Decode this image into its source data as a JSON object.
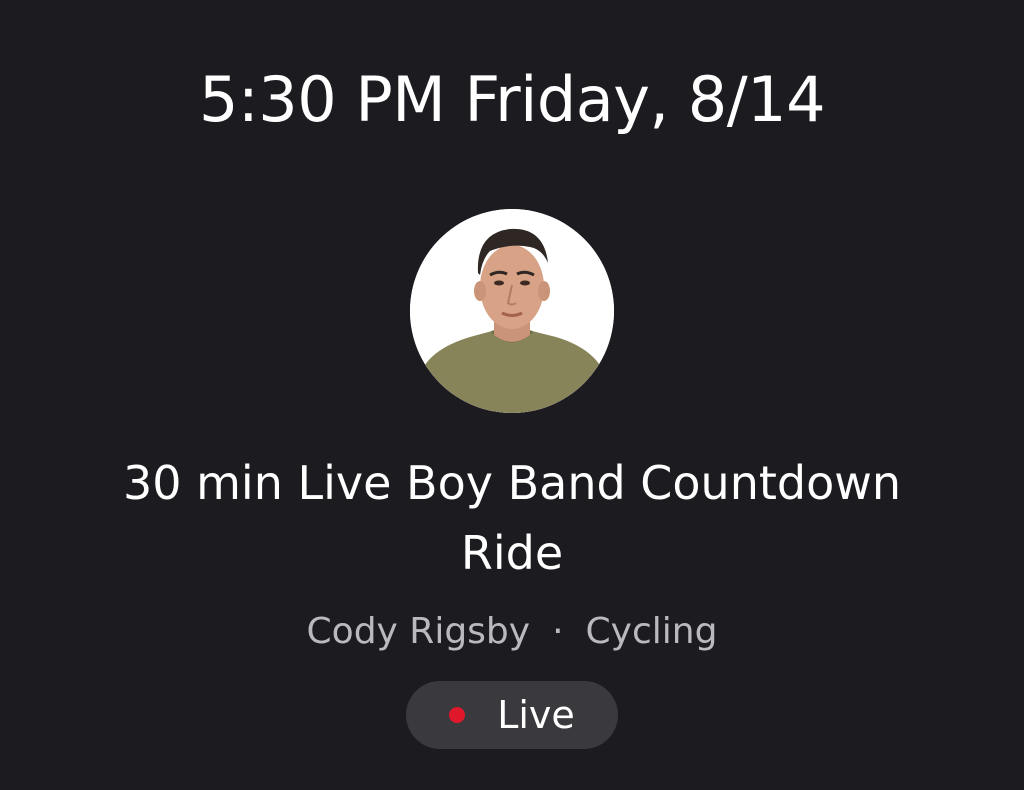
{
  "header": {
    "schedule_time": "5:30 PM Friday, 8/14"
  },
  "instructor": {
    "avatar_icon": "instructor-photo",
    "name": "Cody Rigsby"
  },
  "class": {
    "title": "30 min Live Boy Band Countdown Ride",
    "separator": "·",
    "discipline": "Cycling"
  },
  "status": {
    "label": "Live",
    "dot_color": "#e0182c"
  },
  "colors": {
    "background": "#1c1b20",
    "badge_background": "#3a393e",
    "secondary_text": "#bab9be"
  }
}
